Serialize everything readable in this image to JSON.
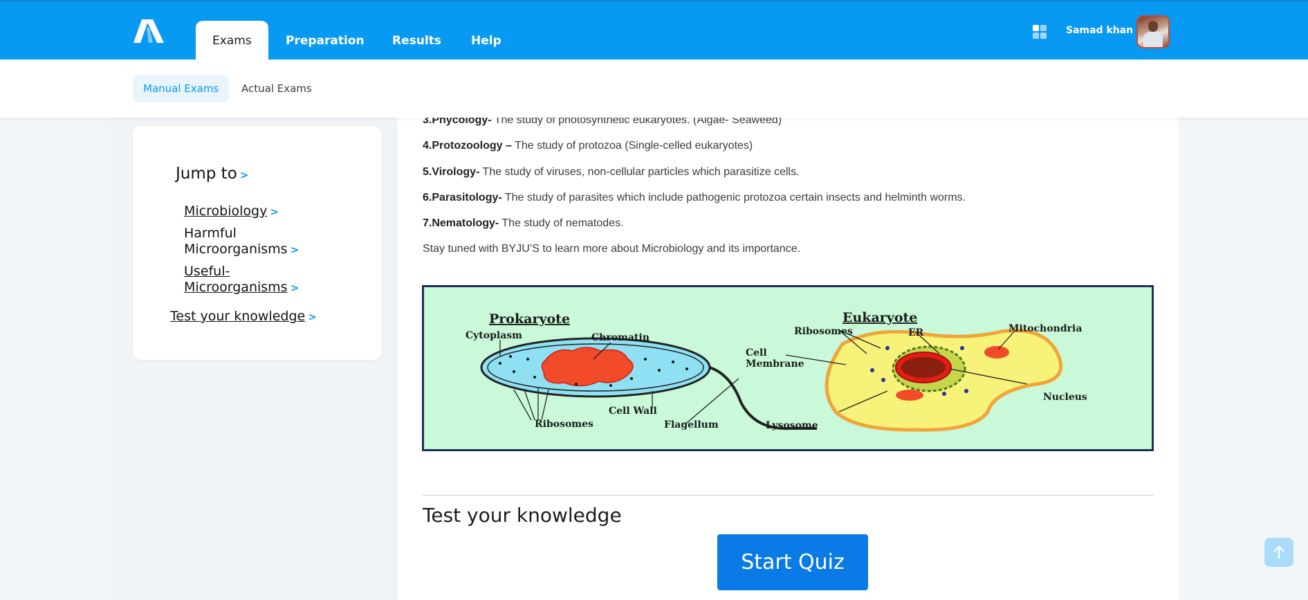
{
  "header": {
    "nav_tabs": [
      {
        "label": "Exams",
        "active": true
      },
      {
        "label": "Preparation",
        "active": false
      },
      {
        "label": "Results",
        "active": false
      },
      {
        "label": "Help",
        "active": false
      }
    ],
    "user_name": "Samad khan",
    "icons": {
      "logo": "brand-logo-icon",
      "apps": "grid-apps-icon",
      "avatar": "user-avatar"
    },
    "brand_color": "#0899f3"
  },
  "subnav": {
    "tabs": [
      {
        "label": "Manual Exams",
        "active": true
      },
      {
        "label": "Actual Exams",
        "active": false
      }
    ]
  },
  "sidebar": {
    "title": "Jump to",
    "links": [
      {
        "line1": "Microbiology",
        "line2": ""
      },
      {
        "line1": "Harmful",
        "line2": "Microorganisms"
      },
      {
        "line1": "Useful-",
        "line2": "Microorganisms"
      }
    ],
    "test_link": "Test your knowledge"
  },
  "content": {
    "items": [
      {
        "term": "3.Phycology-",
        "text": " The study of photosynthetic eukaryotes. (Algae- Seaweed)"
      },
      {
        "term": "4.Protozoology –",
        "text": " The study of protozoa (Single-celled eukaryotes)"
      },
      {
        "term": "5.Virology-",
        "text": " The study of viruses, non-cellular particles which parasitize cells."
      },
      {
        "term": "6.Parasitology-",
        "text": " The study of parasites which include pathogenic protozoa certain insects and helminth worms."
      },
      {
        "term": "7.Nematology-",
        "text": " The study of nematodes."
      }
    ],
    "closing": "Stay tuned with BYJU’S to learn more about Microbiology and its importance."
  },
  "diagram": {
    "prokaryote_title": "Prokaryote",
    "eukaryote_title": "Eukaryote",
    "labels": {
      "cytoplasm": "Cytoplasm",
      "chromatin": "Chromatin",
      "ribosomes_left": "Ribosomes",
      "cell_wall": "Cell Wall",
      "flagellum": "Flagellum",
      "ribosomes_right": "Ribosomes",
      "er": "ER",
      "mitochondria": "Mitochondria",
      "cell_membrane_1": "Cell",
      "cell_membrane_2": "Membrane",
      "lysosome": "Lysosome",
      "nucleus": "Nucleus"
    }
  },
  "quiz": {
    "section_title": "Test your knowledge",
    "button_label": "Start Quiz"
  },
  "scroll_top_icon": "arrow-up-icon"
}
